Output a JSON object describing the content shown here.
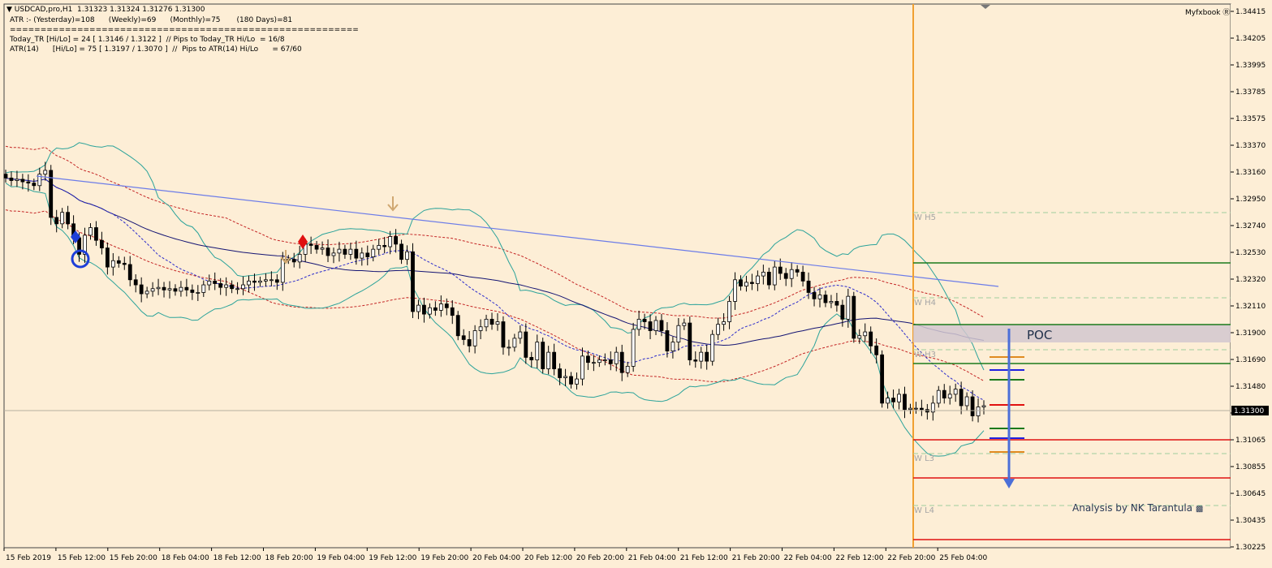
{
  "header": {
    "line1": "USDCAD,pro,H1  1.31323 1.31324 1.31276 1.31300",
    "line2": "ATR :- (Yesterday)=108      (Weekly)=69      (Monthly)=75       (180 Days)=81",
    "line3": "=========================================================",
    "line4": "Today_TR [Hi/Lo] = 24 [ 1.3146 / 1.3122 ]  // Pips to Today_TR Hi/Lo  = 16/8",
    "line5": "ATR(14)      [Hi/Lo] = 75 [ 1.3197 / 1.3070 ]  //  Pips to ATR(14) Hi/Lo      = 67/60"
  },
  "brand": "Myfxbook",
  "credit": "Analysis by NK Tarantula",
  "poc_label": "POC",
  "colors": {
    "background": "#fdeed6",
    "bull_candle": "#ffffff",
    "bear_candle": "#000000",
    "trendline": "#6c7ce8",
    "bollinger": "#2ba39a",
    "envelope": "#c42525",
    "moving_average": "#141473",
    "pivot_green": "#1b7a1b",
    "pivot_red": "#e01010",
    "session_line": "#f0a030",
    "poc_band": "#d2c7cf",
    "arrow": "#4c6fd8"
  },
  "chart_data": {
    "type": "candlestick",
    "symbol": "USDCAD,pro",
    "timeframe": "H1",
    "last_price": "1.31300",
    "ylim": [
      1.3022,
      1.3443
    ],
    "y_ticks": [
      "1.34415",
      "1.34205",
      "1.33995",
      "1.33785",
      "1.33575",
      "1.33370",
      "1.33160",
      "1.32950",
      "1.32740",
      "1.32530",
      "1.32320",
      "1.32110",
      "1.31900",
      "1.31690",
      "1.31480",
      "1.31270",
      "1.31065",
      "1.30855",
      "1.30645",
      "1.30435",
      "1.30225"
    ],
    "x_ticks": [
      "15 Feb 2019",
      "15 Feb 12:00",
      "15 Feb 20:00",
      "18 Feb 04:00",
      "18 Feb 12:00",
      "18 Feb 20:00",
      "19 Feb 04:00",
      "19 Feb 12:00",
      "19 Feb 20:00",
      "20 Feb 04:00",
      "20 Feb 12:00",
      "20 Feb 20:00",
      "21 Feb 04:00",
      "21 Feb 12:00",
      "21 Feb 20:00",
      "22 Feb 04:00",
      "22 Feb 12:00",
      "22 Feb 20:00",
      "25 Feb 04:00"
    ],
    "price_path": [
      1.3312,
      1.331,
      1.3311,
      1.3309,
      1.3308,
      1.3306,
      1.3315,
      1.3318,
      1.3281,
      1.3276,
      1.3285,
      1.3276,
      1.3265,
      1.3252,
      1.3267,
      1.3273,
      1.3263,
      1.3257,
      1.3242,
      1.3247,
      1.3245,
      1.3244,
      1.3232,
      1.3228,
      1.3221,
      1.3223,
      1.3225,
      1.3226,
      1.3224,
      1.3225,
      1.3223,
      1.3226,
      1.3224,
      1.3222,
      1.3222,
      1.3228,
      1.3231,
      1.3229,
      1.3226,
      1.3228,
      1.3225,
      1.3225,
      1.3228,
      1.3231,
      1.323,
      1.3231,
      1.3232,
      1.3232,
      1.323,
      1.3248,
      1.3248,
      1.3246,
      1.3252,
      1.326,
      1.3259,
      1.3256,
      1.3257,
      1.3251,
      1.3253,
      1.3256,
      1.3252,
      1.3256,
      1.3249,
      1.3253,
      1.325,
      1.3256,
      1.3259,
      1.3258,
      1.3266,
      1.326,
      1.3248,
      1.3254,
      1.3207,
      1.3212,
      1.3205,
      1.321,
      1.3208,
      1.3213,
      1.321,
      1.3204,
      1.3188,
      1.3185,
      1.318,
      1.3192,
      1.3195,
      1.3201,
      1.3197,
      1.3199,
      1.3179,
      1.3179,
      1.3186,
      1.3191,
      1.3171,
      1.3169,
      1.3183,
      1.3162,
      1.3175,
      1.3162,
      1.3155,
      1.3156,
      1.315,
      1.3154,
      1.3172,
      1.3167,
      1.3167,
      1.3169,
      1.3169,
      1.3166,
      1.3175,
      1.3159,
      1.3164,
      1.3193,
      1.3201,
      1.3199,
      1.3192,
      1.32,
      1.3192,
      1.3176,
      1.3183,
      1.3196,
      1.3198,
      1.3169,
      1.3168,
      1.3175,
      1.3168,
      1.3189,
      1.3197,
      1.3199,
      1.3215,
      1.3232,
      1.3227,
      1.323,
      1.3229,
      1.3235,
      1.3238,
      1.3228,
      1.3242,
      1.3237,
      1.3233,
      1.324,
      1.3238,
      1.3231,
      1.3222,
      1.3217,
      1.322,
      1.3214,
      1.3215,
      1.3212,
      1.3201,
      1.3219,
      1.3186,
      1.3188,
      1.3191,
      1.318,
      1.3173,
      1.3135,
      1.3139,
      1.3136,
      1.3142,
      1.313,
      1.3131,
      1.3131,
      1.313,
      1.3128,
      1.3135,
      1.3145,
      1.3139,
      1.3142,
      1.3146,
      1.3133,
      1.314,
      1.3125,
      1.3132,
      1.3133
    ],
    "pivot_levels": [
      {
        "label": "W  H5",
        "price": 1.3283
      },
      {
        "label": "W  H4",
        "price": 1.3216
      },
      {
        "label": "W  H3",
        "price": 1.3174
      },
      {
        "label": "W  L3",
        "price": 1.3087
      },
      {
        "label": "W  L4",
        "price": 1.3046
      }
    ]
  }
}
